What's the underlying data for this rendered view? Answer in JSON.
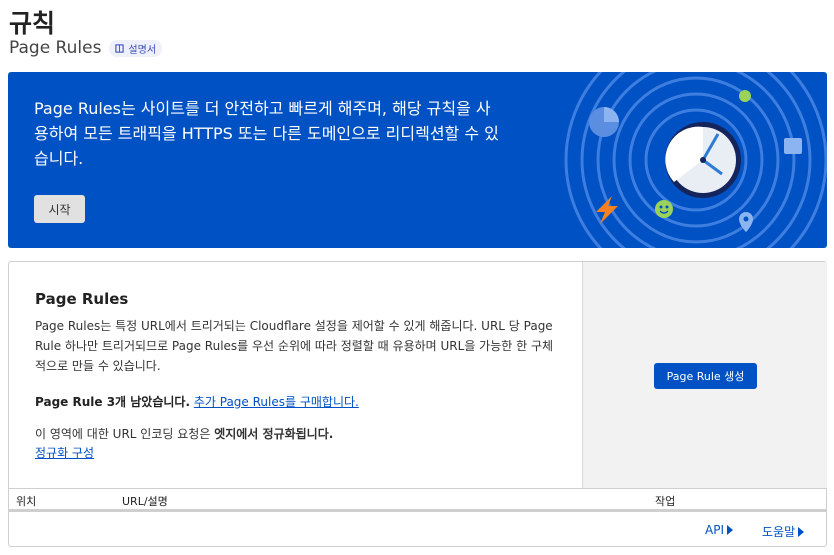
{
  "header": {
    "title": "규칙",
    "subtitle": "Page Rules",
    "doc_badge": "설명서"
  },
  "banner": {
    "text": "Page Rules는 사이트를 더 안전하고 빠르게 해주며, 해당 규칙을 사용하여 모든 트래픽을 HTTPS 또는 다른 도메인으로 리디렉션할 수 있습니다.",
    "button_label": "시작",
    "background_color": "#0051c3"
  },
  "card": {
    "heading": "Page Rules",
    "description": "Page Rules는 특정 URL에서 트리거되는 Cloudflare 설정을 제어할 수 있게 해줍니다. URL 당 Page Rule 하나만 트리거되므로 Page Rules를 우선 순위에 따라 정렬할 때 유용하며 URL을 가능한 한 구체적으로 만들 수 있습니다.",
    "remaining_bold": "Page Rule 3개 남았습니다.",
    "purchase_link": "추가 Page Rules를 구매합니다.",
    "encoding_text_prefix": "이 영역에 대한 URL 인코딩 요청은 ",
    "encoding_text_bold": "엣지에서 정규화됩니다.",
    "normalize_link": "정규화 구성",
    "create_button": "Page Rule 생성"
  },
  "table": {
    "columns": [
      "위치",
      "URL/설명",
      "작업"
    ]
  },
  "footer": {
    "api_link": "API",
    "help_link": "도움말"
  },
  "icons": [
    "document-icon",
    "pie-chart-icon",
    "check-badge-icon",
    "bolt-icon",
    "smiley-icon",
    "folder-icon",
    "location-pin-icon",
    "clock-icon",
    "caret-right-icon"
  ]
}
